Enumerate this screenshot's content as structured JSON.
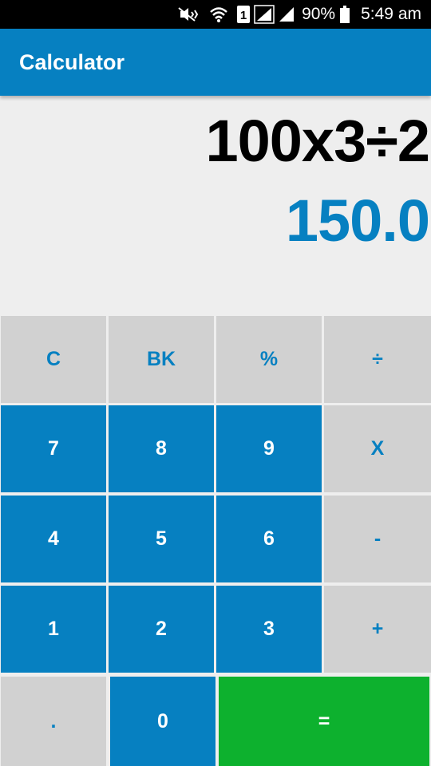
{
  "status_bar": {
    "battery": "90%",
    "time": "5:49 am",
    "sim_badge": "1"
  },
  "app_bar": {
    "title": "Calculator"
  },
  "display": {
    "expression": "100x3÷2",
    "result": "150.0",
    "result_color": "#0680c1"
  },
  "colors": {
    "primary": "#0680c1",
    "equals": "#0db12e",
    "operator_bg": "#d1d1d1"
  },
  "keys": {
    "clear": "C",
    "backspace": "BK",
    "percent": "%",
    "divide": "÷",
    "seven": "7",
    "eight": "8",
    "nine": "9",
    "multiply": "X",
    "four": "4",
    "five": "5",
    "six": "6",
    "minus": "-",
    "one": "1",
    "two": "2",
    "three": "3",
    "plus": "+",
    "decimal": ".",
    "zero": "0",
    "equals": "="
  }
}
